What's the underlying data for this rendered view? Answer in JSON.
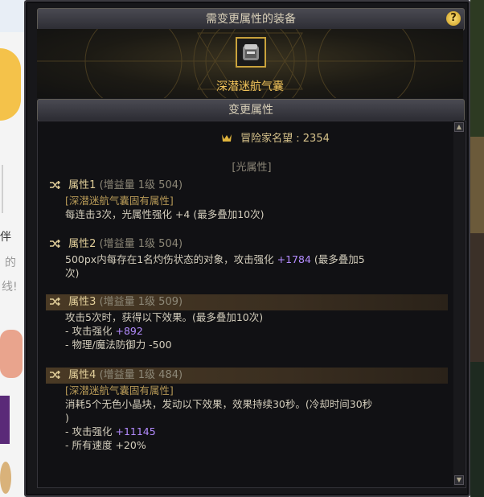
{
  "window": {
    "title": "需变更属性的装备",
    "help_label": "?",
    "item_name": "深潜迷航气囊",
    "section_title": "变更属性"
  },
  "fame": {
    "label": "冒险家名望 : 2354"
  },
  "light_attr": "[光属性]",
  "attributes": [
    {
      "name": "属性1",
      "meta": "(增益量 1级 504)",
      "inherent": "[深潜迷航气囊固有属性]",
      "lines": [
        {
          "text": "每连击3次，光属性强化 +4 (最多叠加10次)"
        }
      ]
    },
    {
      "name": "属性2",
      "meta": "(增益量 1级 504)",
      "lines": [
        {
          "pre": "500px内每存在1名灼伤状态的对象，攻击强化 ",
          "num": "+1784",
          "post": " (最多叠加5"
        },
        {
          "text": "次)"
        }
      ]
    },
    {
      "name": "属性3",
      "meta": "(增益量 1级 509)",
      "lines": [
        {
          "text": "攻击5次时，获得以下效果。(最多叠加10次)"
        },
        {
          "pre": "- 攻击强化 ",
          "num": "+892"
        },
        {
          "text": "- 物理/魔法防御力 -500"
        }
      ]
    },
    {
      "name": "属性4",
      "meta": "(增益量 1级 484)",
      "inherent": "[深潜迷航气囊固有属性]",
      "lines": [
        {
          "text": "消耗5个无色小晶块，发动以下效果，效果持续30秒。(冷却时间30秒"
        },
        {
          "text": ")"
        },
        {
          "pre": "- 攻击强化 ",
          "num": "+11145"
        },
        {
          "text": "- 所有速度 +20%"
        }
      ]
    }
  ],
  "background_text": {
    "a": "伴",
    "b": "的",
    "c": "线!"
  },
  "colors": {
    "accent": "#f1c35a",
    "number": "#b48cff",
    "inherent": "#b89a57"
  },
  "icons": [
    "help-icon",
    "item-icon",
    "fame-icon",
    "shuffle-icon",
    "scroll-up-icon",
    "scroll-down-icon"
  ]
}
